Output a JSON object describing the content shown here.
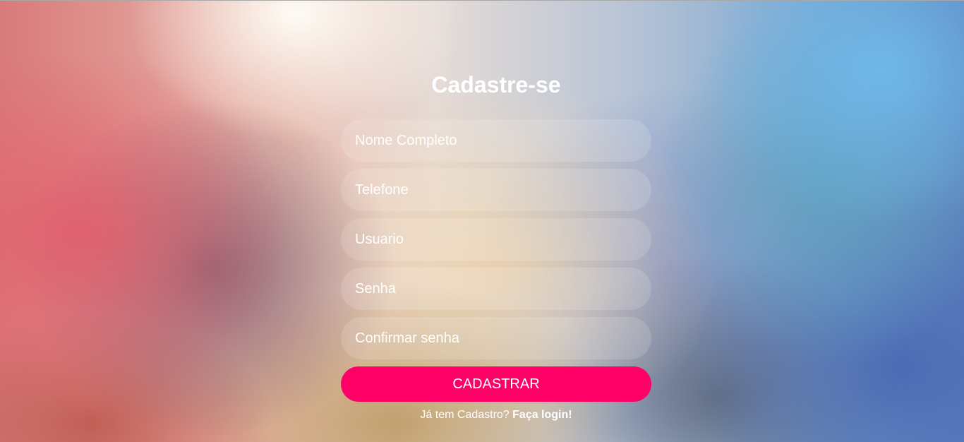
{
  "form": {
    "title": "Cadastre-se",
    "fields": [
      {
        "placeholder": "Nome Completo",
        "value": ""
      },
      {
        "placeholder": "Telefone",
        "value": ""
      },
      {
        "placeholder": "Usuario",
        "value": ""
      },
      {
        "placeholder": "Senha",
        "value": ""
      },
      {
        "placeholder": "Confirmar senha",
        "value": ""
      }
    ],
    "submit_label": "CADASTRAR",
    "login_prompt": "Já tem Cadastro?",
    "login_link": "Faça login!"
  },
  "colors": {
    "accent": "#ff0066",
    "text": "#ffffff"
  }
}
